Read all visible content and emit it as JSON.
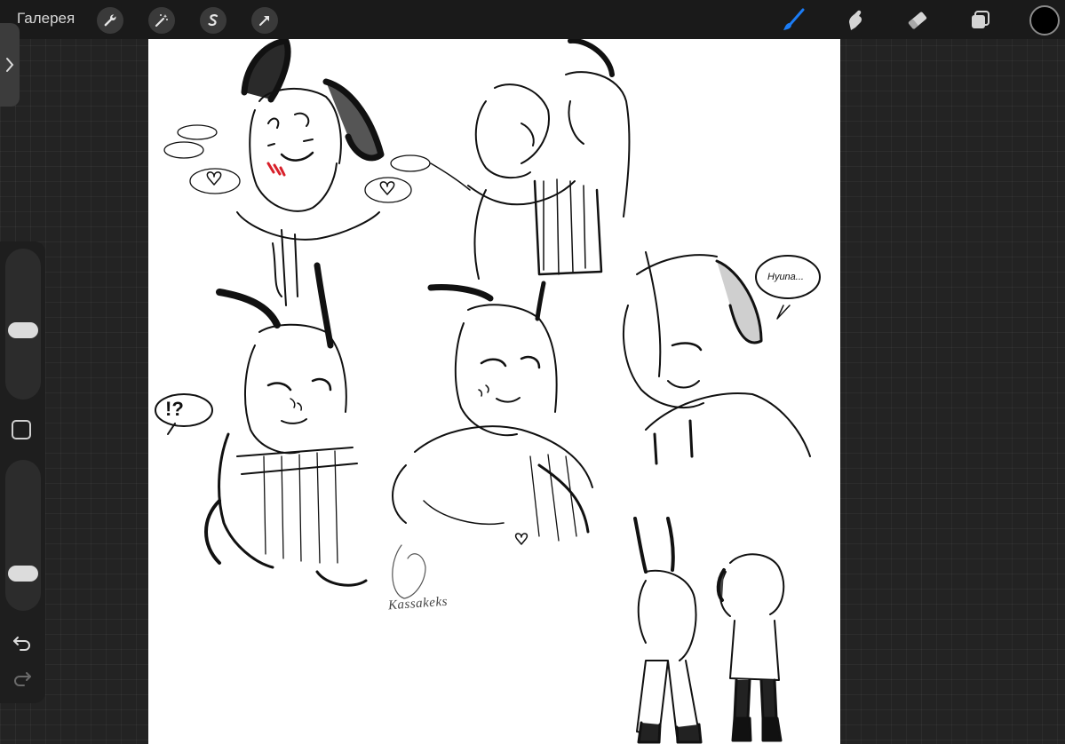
{
  "toolbar": {
    "gallery_label": "Галерея",
    "left_tools": [
      "wrench-icon",
      "magic-wand-icon",
      "selection-icon",
      "transform-arrow-icon"
    ],
    "right_tools": [
      "brush-icon",
      "smudge-icon",
      "eraser-icon",
      "layers-icon"
    ],
    "active_tool": "brush",
    "active_color": "#000000",
    "accent_color": "#1b7cf5"
  },
  "sidebar": {
    "brush_size_level": 0.45,
    "opacity_level": 0.2
  },
  "canvas": {
    "signature": "Kassakeks",
    "bubble_exclaim": "!?",
    "bubble_name": "Hyuna..."
  }
}
